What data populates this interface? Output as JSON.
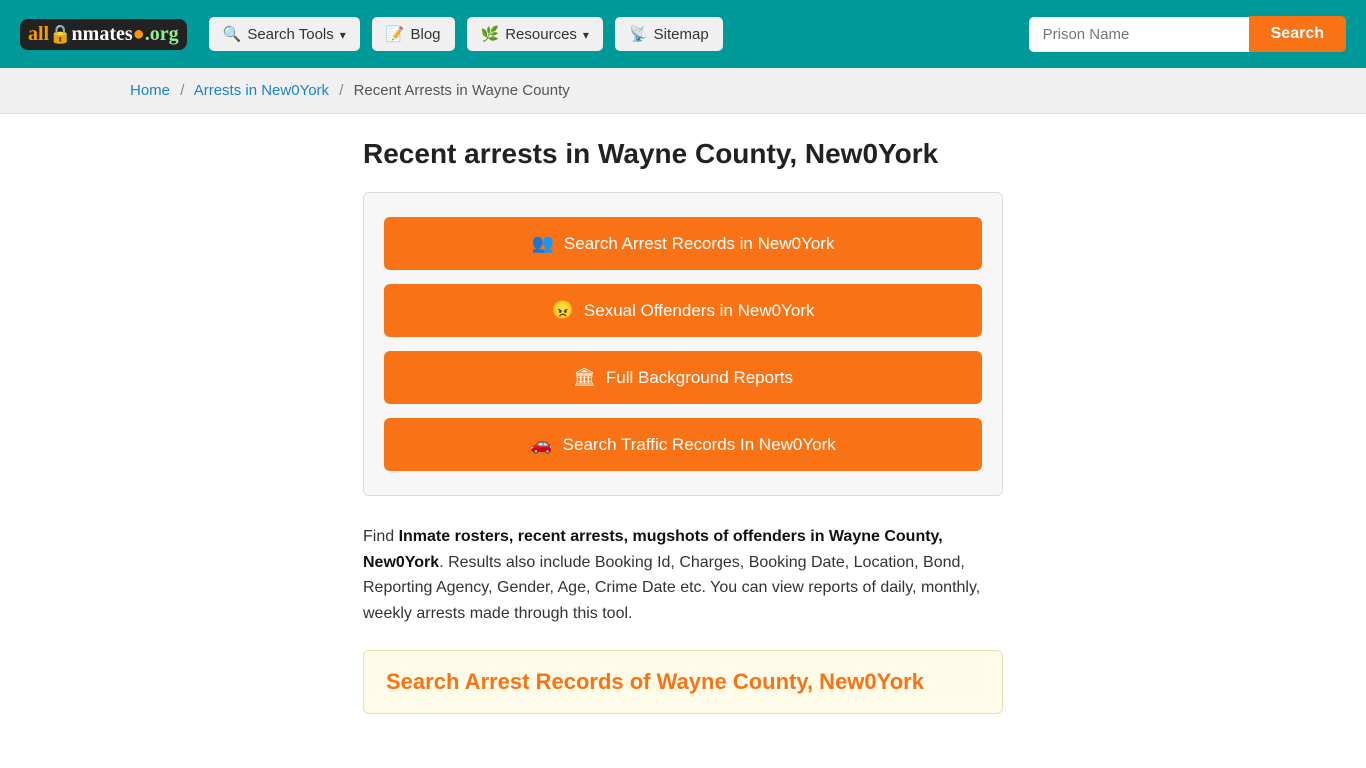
{
  "header": {
    "logo": {
      "all": "all",
      "inmates": "Inmates",
      "org": ".org"
    },
    "nav": {
      "search_tools": "Search Tools",
      "blog": "Blog",
      "resources": "Resources",
      "sitemap": "Sitemap"
    },
    "search_placeholder": "Prison Name",
    "search_button": "Search"
  },
  "breadcrumb": {
    "home": "Home",
    "arrests_in_new0york": "Arrests in New0York",
    "recent_arrests": "Recent Arrests in Wayne County"
  },
  "page": {
    "title": "Recent arrests in Wayne County, New0York",
    "action_buttons": [
      {
        "label": "Search Arrest Records in New0York",
        "icon": "👥"
      },
      {
        "label": "Sexual Offenders in New0York",
        "icon": "😠"
      },
      {
        "label": "Full Background Reports",
        "icon": "🏛"
      },
      {
        "label": "Search Traffic Records In New0York",
        "icon": "🚗"
      }
    ],
    "description_prefix": "Find ",
    "description_bold": "Inmate rosters, recent arrests, mugshots of offenders in Wayne County, New0York",
    "description_suffix": ". Results also include Booking Id, Charges, Booking Date, Location, Bond, Reporting Agency, Gender, Age, Crime Date etc. You can view reports of daily, monthly, weekly arrests made through this tool.",
    "bottom_section_title": "Search Arrest Records of Wayne County, New0York"
  }
}
